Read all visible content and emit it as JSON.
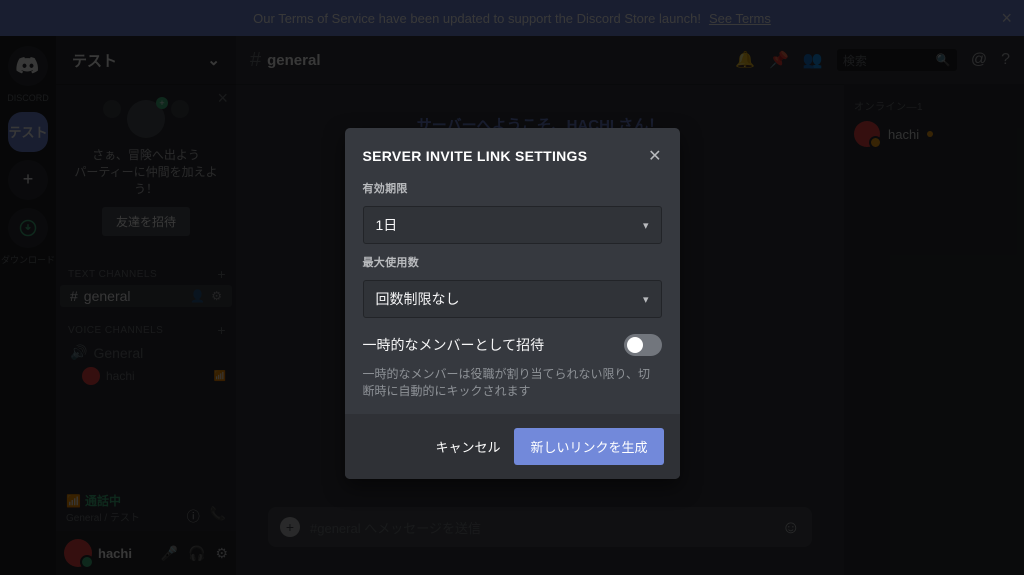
{
  "notice": {
    "text": "Our Terms of Service have been updated to support the Discord Store launch!",
    "link": "See Terms"
  },
  "guilds": {
    "home_label": "DISCORD",
    "selected_name": "テスト",
    "download_label": "ダウンロード"
  },
  "server": {
    "name": "テスト"
  },
  "onboard": {
    "line1": "さぁ、冒険へ出よう",
    "line2": "パーティーに仲間を加えよう！",
    "button": "友達を招待"
  },
  "categories": {
    "text_label": "TEXT CHANNELS",
    "voice_label": "VOICE CHANNELS"
  },
  "channels": {
    "text": {
      "name": "general"
    },
    "voice": {
      "name": "General"
    },
    "voice_user": {
      "name": "hachi"
    }
  },
  "voice_status": {
    "title": "通話中",
    "sub": "General / テスト"
  },
  "user_panel": {
    "name": "hachi"
  },
  "chat": {
    "channel_name": "general",
    "welcome": "サーバーへようこそ、HACHI さん！",
    "search_placeholder": "検索",
    "compose_placeholder": "#general へメッセージを送信"
  },
  "members": {
    "role_label": "オンライン—1",
    "user": "hachi"
  },
  "modal": {
    "title": "SERVER INVITE LINK SETTINGS",
    "expire_label": "有効期限",
    "expire_value": "1日",
    "max_uses_label": "最大使用数",
    "max_uses_value": "回数制限なし",
    "temp_label": "一時的なメンバーとして招待",
    "temp_desc": "一時的なメンバーは役職が割り当てられない限り、切断時に自動的にキックされます",
    "cancel": "キャンセル",
    "confirm": "新しいリンクを生成"
  }
}
